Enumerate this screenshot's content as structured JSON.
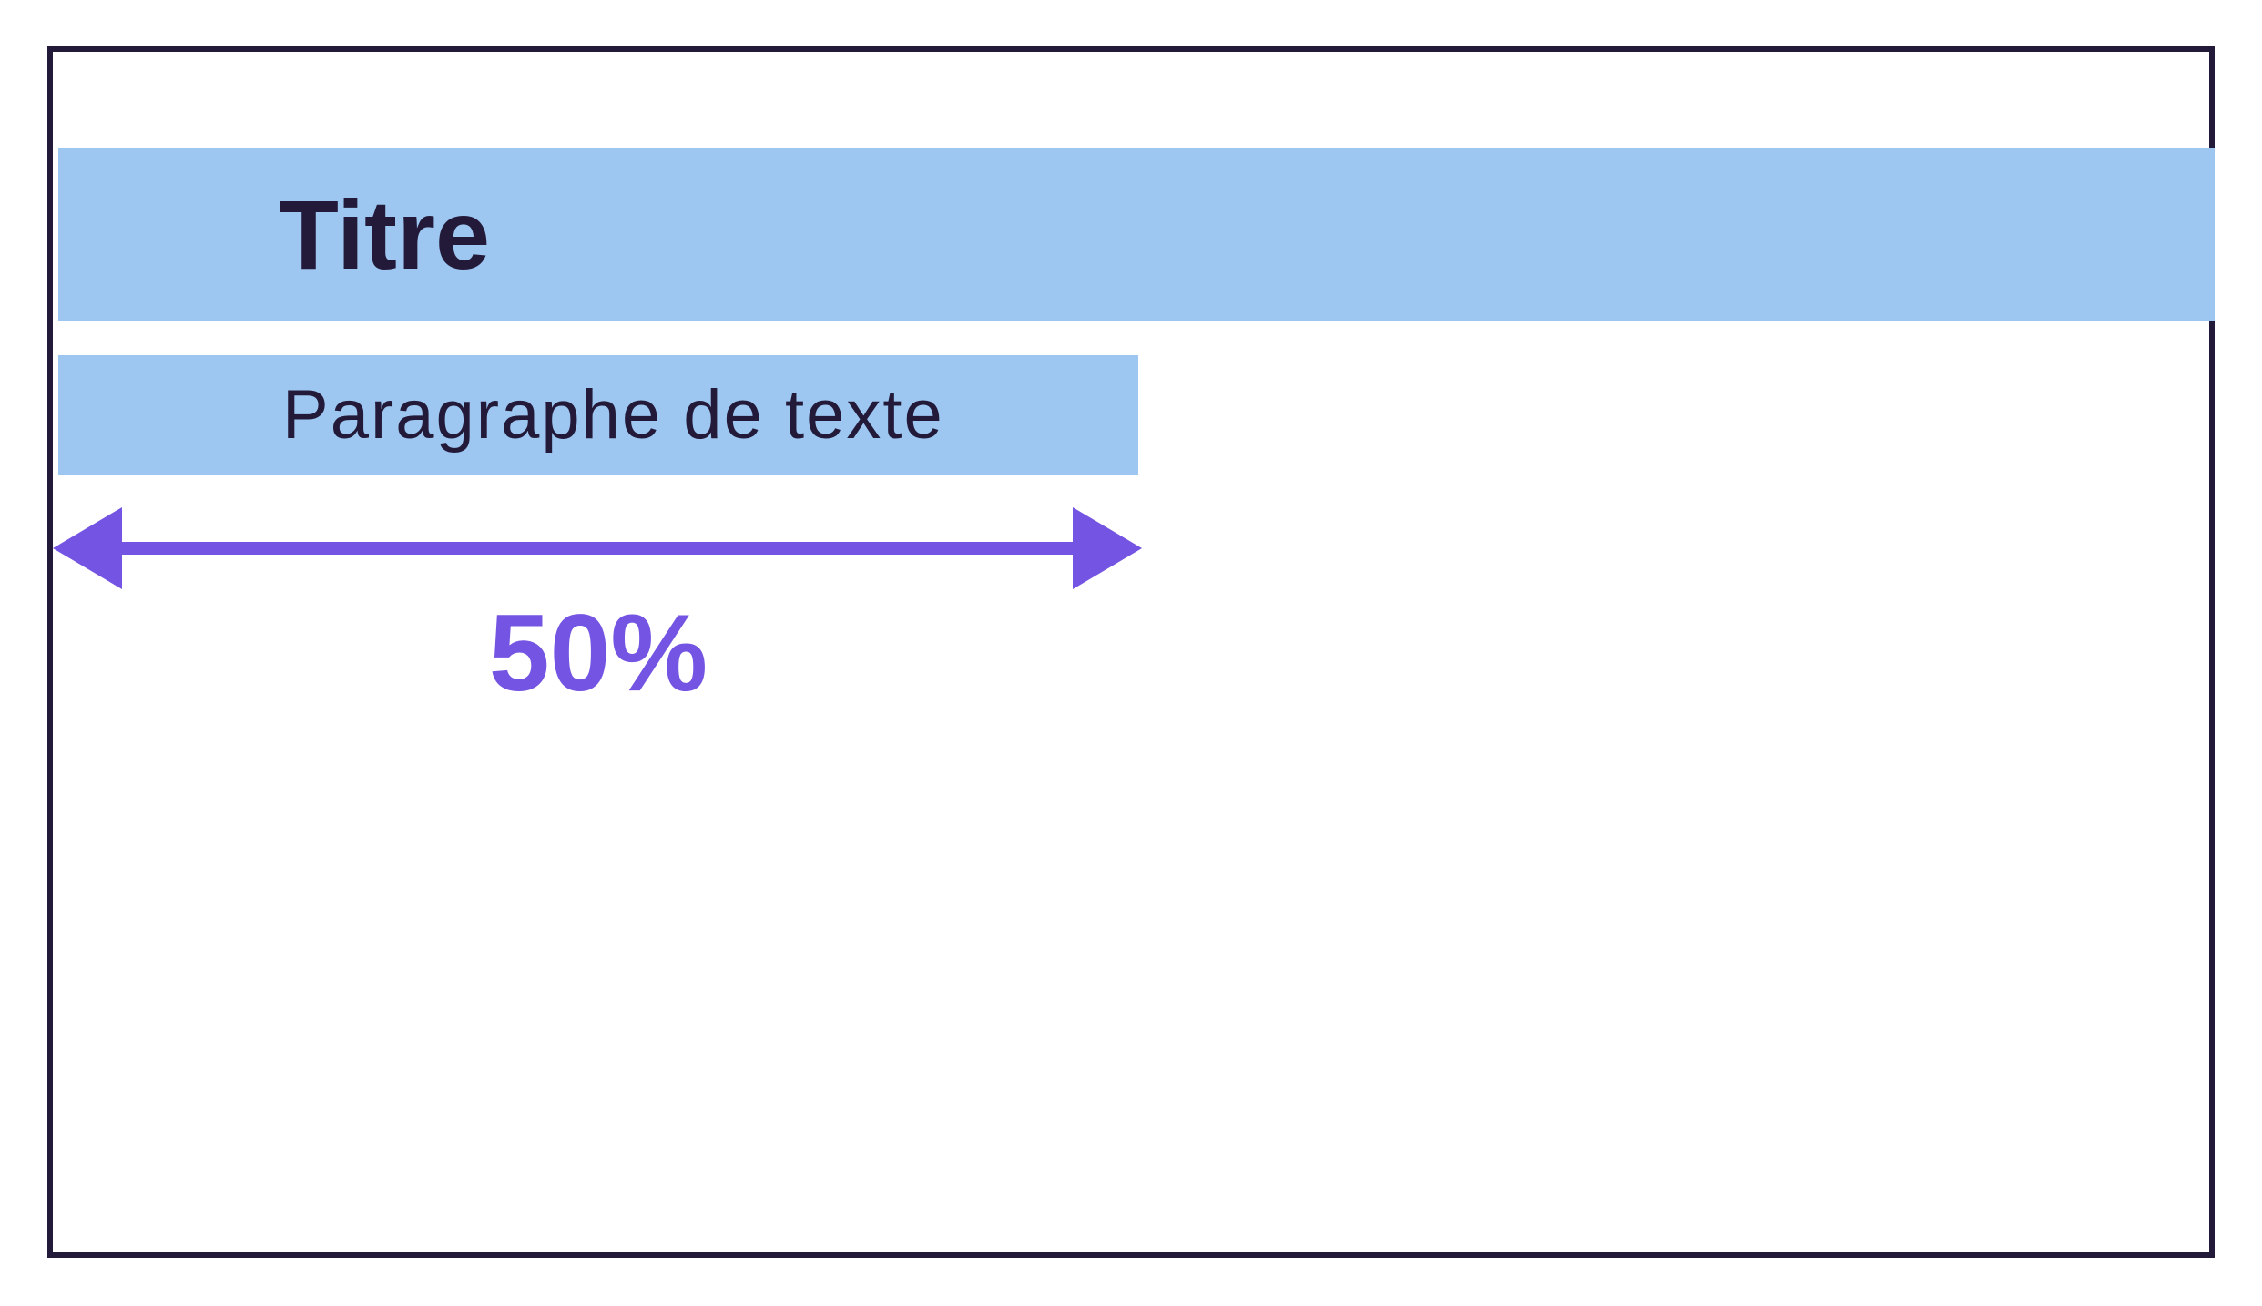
{
  "title": "Titre",
  "paragraph": "Paragraphe de texte",
  "width_label": "50%",
  "paragraph_width_fraction": 0.5,
  "colors": {
    "frame": "#231a3a",
    "band": "#9dc7f1",
    "text": "#231a3a",
    "accent": "#7454e2"
  }
}
